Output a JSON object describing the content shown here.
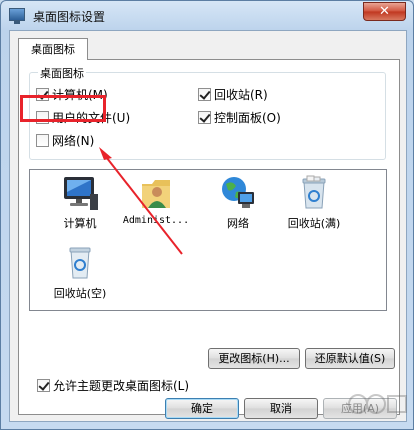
{
  "window": {
    "title": "桌面图标设置",
    "close_glyph": "✕"
  },
  "tab": {
    "label": "桌面图标"
  },
  "group": {
    "title": "桌面图标",
    "checkboxes": [
      {
        "label": "计算机(M)",
        "checked": true
      },
      {
        "label": "回收站(R)",
        "checked": true
      },
      {
        "label": "用户的文件(U)",
        "checked": false
      },
      {
        "label": "控制面板(O)",
        "checked": true
      },
      {
        "label": "网络(N)",
        "checked": false
      }
    ]
  },
  "icons": [
    {
      "label": "计算机",
      "icon": "computer-icon"
    },
    {
      "label": "Administ...",
      "icon": "user-folder-icon"
    },
    {
      "label": "网络",
      "icon": "network-icon"
    },
    {
      "label": "回收站(满)",
      "icon": "recycle-bin-full-icon"
    },
    {
      "label": "回收站(空)",
      "icon": "recycle-bin-empty-icon"
    }
  ],
  "buttons": {
    "change_icon": "更改图标(H)...",
    "restore_default": "还原默认值(S)",
    "ok": "确定",
    "cancel": "取消",
    "apply": "应用(A)"
  },
  "allow_themes": {
    "label": "允许主题更改桌面图标(L)",
    "checked": true
  },
  "colors": {
    "highlight": "#e8232b",
    "arrow": "#e8232b"
  }
}
